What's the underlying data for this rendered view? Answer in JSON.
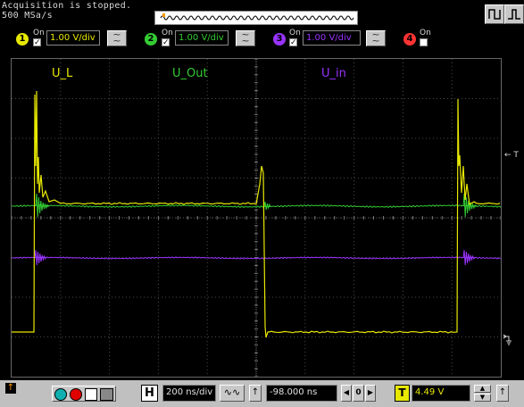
{
  "status": {
    "line1": "Acquisition is stopped.",
    "line2": "500 MSa/s"
  },
  "channels": [
    {
      "num": "1",
      "on_label": "On",
      "scale": "1.00 V/div",
      "color": "#e8e800",
      "checked": true
    },
    {
      "num": "2",
      "on_label": "On",
      "scale": "1.00 V/div",
      "color": "#33cc33",
      "checked": true
    },
    {
      "num": "3",
      "on_label": "On",
      "scale": "1.00 V/div",
      "color": "#9933ff",
      "checked": true
    },
    {
      "num": "4",
      "on_label": "On",
      "color": "#ff3333",
      "checked": false
    }
  ],
  "traces": {
    "ul_label": "U_L",
    "uout_label": "U_Out",
    "uin_label": "U_in",
    "trigger_label": "← T"
  },
  "bottom": {
    "h_label": "H",
    "timebase": "200 ns/div",
    "delay": "-98.000 ns",
    "t_label": "T",
    "trigger_level": "4.49 V"
  },
  "colors": {
    "ch1": "#e8e800",
    "ch2": "#33cc33",
    "ch3": "#9933ff",
    "ch4": "#ff3333",
    "grid": "#4a4a4a",
    "orange_marker": "#ff9900"
  }
}
